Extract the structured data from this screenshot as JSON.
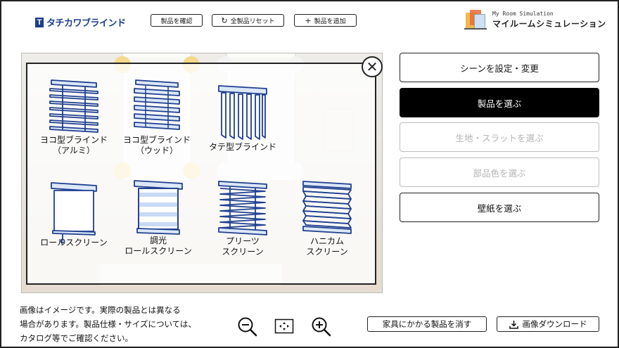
{
  "header": {
    "brand_mark": "T",
    "brand_name": "タチカワブラインド",
    "confirm_label": "製品を確認",
    "reset_label": "全製品リセット",
    "add_label": "製品を追加",
    "app_subtitle": "My Room Simulation",
    "app_title": "マイルームシミュレーション"
  },
  "icons": {
    "reset": "reset-icon",
    "add": "plus-icon",
    "close": "close-icon",
    "zoom_out": "zoom-out-icon",
    "fit": "fit-screen-icon",
    "zoom_in": "zoom-in-icon",
    "download": "download-icon"
  },
  "close_glyph": "✕",
  "products": [
    {
      "line1": "ヨコ型ブラインド",
      "line2": "（アルミ）",
      "icon": "venetian-blind-icon"
    },
    {
      "line1": "ヨコ型ブラインド",
      "line2": "（ウッド）",
      "icon": "wood-blind-icon"
    },
    {
      "line1": "タテ型ブラインド",
      "line2": "",
      "icon": "vertical-blind-icon"
    },
    {
      "line1": "ロールスクリーン",
      "line2": "",
      "icon": "roll-screen-icon"
    },
    {
      "line1": "調光",
      "line2": "ロールスクリーン",
      "icon": "dimming-roll-screen-icon"
    },
    {
      "line1": "プリーツ",
      "line2": "スクリーン",
      "icon": "pleated-screen-icon"
    },
    {
      "line1": "ハニカム",
      "line2": "スクリーン",
      "icon": "honeycomb-screen-icon"
    }
  ],
  "menu": [
    {
      "label": "シーンを設定・変更",
      "state": "normal"
    },
    {
      "label": "製品を選ぶ",
      "state": "active"
    },
    {
      "label": "生地・スラットを選ぶ",
      "state": "disabled"
    },
    {
      "label": "部品色を選ぶ",
      "state": "disabled"
    },
    {
      "label": "壁紙を選ぶ",
      "state": "normal"
    }
  ],
  "footer": {
    "note_line1": "画像はイメージです。実際の製品とは異なる",
    "note_line2": "場合があります。製品仕様・サイズについては、",
    "note_line3": "カタログ等でご確認ください。",
    "remove_label": "家具にかかる製品を消す",
    "download_label": "画像ダウンロード"
  },
  "colors": {
    "icon_stroke": "#1f3f8f",
    "icon_fill": "#dce8f8",
    "brand": "#1a3e8c",
    "active_bg": "#000000",
    "disabled_text": "#b3b3b3"
  }
}
